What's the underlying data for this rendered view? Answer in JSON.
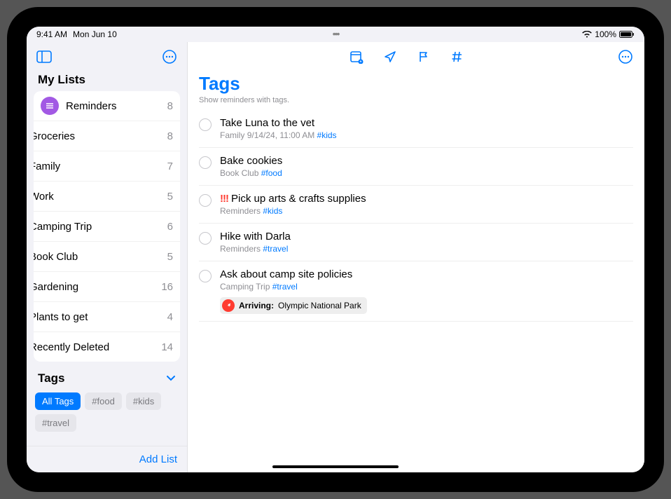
{
  "status": {
    "time": "9:41 AM",
    "date": "Mon Jun 10",
    "battery": "100%"
  },
  "sidebar": {
    "title": "My Lists",
    "lists": [
      {
        "name": "Reminders",
        "count": "8",
        "color": "#a259e4",
        "icon": "list"
      },
      {
        "name": "Groceries",
        "count": "8",
        "color": "#ff9500",
        "icon": "cart"
      },
      {
        "name": "Family",
        "count": "7",
        "color": "#007aff",
        "icon": "home"
      },
      {
        "name": "Work",
        "count": "5",
        "color": "#ff3b30",
        "icon": "star"
      },
      {
        "name": "Camping Trip",
        "count": "6",
        "color": "#a2845e",
        "icon": "tent"
      },
      {
        "name": "Book Club",
        "count": "5",
        "color": "#ffcc00",
        "icon": "bookmark"
      },
      {
        "name": "Gardening",
        "count": "16",
        "color": "#e8a0a8",
        "icon": "flower"
      },
      {
        "name": "Plants to get",
        "count": "4",
        "color": "#30d158",
        "icon": "leaf"
      },
      {
        "name": "Recently Deleted",
        "count": "14",
        "color": "#d1d1d6",
        "icon": "trash"
      }
    ],
    "tags_title": "Tags",
    "tags": [
      {
        "label": "All Tags",
        "active": true
      },
      {
        "label": "#food",
        "active": false
      },
      {
        "label": "#kids",
        "active": false
      },
      {
        "label": "#travel",
        "active": false
      }
    ],
    "add_list": "Add List"
  },
  "main": {
    "title": "Tags",
    "subtitle": "Show reminders with tags.",
    "reminders": [
      {
        "title": "Take Luna to the vet",
        "list": "Family",
        "extra": "9/14/24, 11:00 AM",
        "tag": "#kids",
        "priority": ""
      },
      {
        "title": "Bake cookies",
        "list": "Book Club",
        "extra": "",
        "tag": "#food",
        "priority": ""
      },
      {
        "title": "Pick up arts & crafts supplies",
        "list": "Reminders",
        "extra": "",
        "tag": "#kids",
        "priority": "!!!"
      },
      {
        "title": "Hike with Darla",
        "list": "Reminders",
        "extra": "",
        "tag": "#travel",
        "priority": ""
      },
      {
        "title": "Ask about camp site policies",
        "list": "Camping Trip",
        "extra": "",
        "tag": "#travel",
        "priority": "",
        "location_label": "Arriving:",
        "location": "Olympic National Park"
      }
    ]
  }
}
